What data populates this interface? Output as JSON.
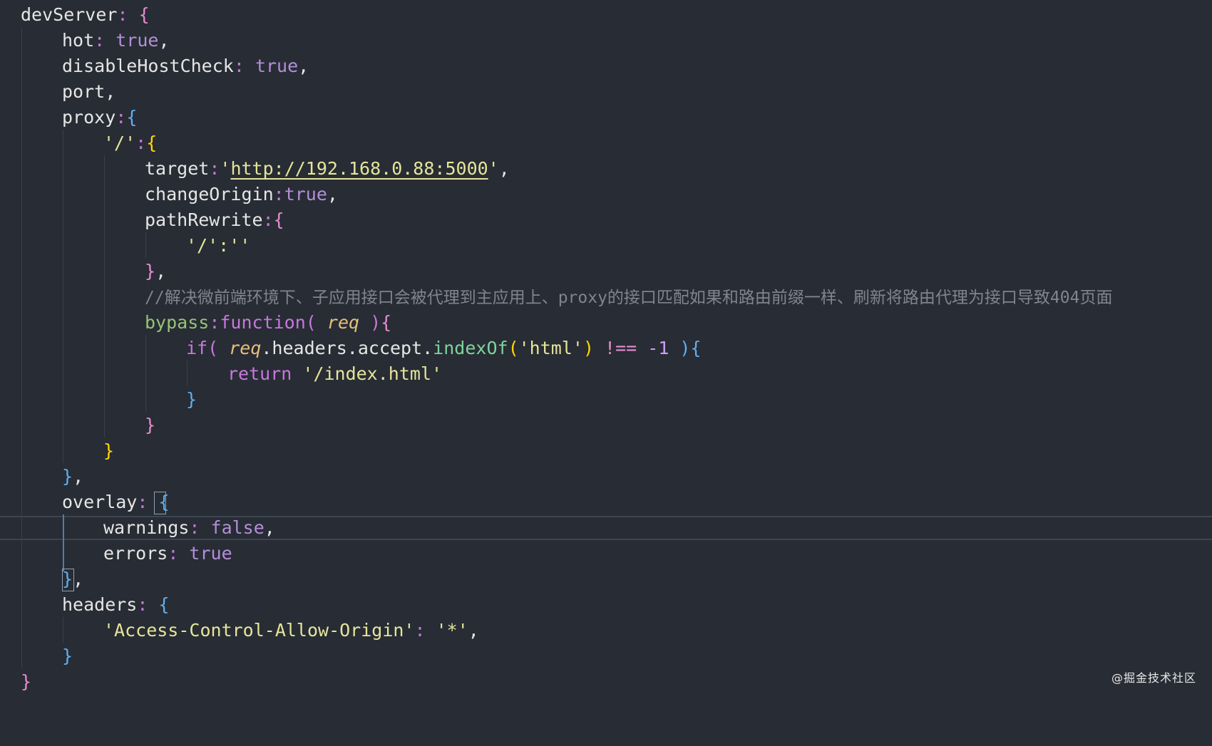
{
  "editor": {
    "lines": {
      "l1": {
        "key": "devServer",
        "colon": ": ",
        "open": "{"
      },
      "l2": {
        "key": "hot",
        "colon": ": ",
        "value": "true",
        "comma": ","
      },
      "l3": {
        "key": "disableHostCheck",
        "colon": ": ",
        "value": "true",
        "comma": ","
      },
      "l4": {
        "text": "port,"
      },
      "l5": {
        "key": "proxy",
        "colon": ":",
        "open": "{"
      },
      "l6": {
        "key": "'/'",
        "colon": ":",
        "open": "{"
      },
      "l7": {
        "key": "target",
        "colon": ":",
        "q1": "'",
        "url": "http://192.168.0.88:5000",
        "q2": "'",
        "comma": ","
      },
      "l8": {
        "key": "changeOrigin",
        "colon": ":",
        "value": "true",
        "comma": ","
      },
      "l9": {
        "key": "pathRewrite",
        "colon": ":",
        "open": "{"
      },
      "l10": {
        "text": "'/':''"
      },
      "l11": {
        "close": "}",
        "comma": ","
      },
      "l12": {
        "comment": "//解决微前端环境下、子应用接口会被代理到主应用上、proxy的接口匹配如果和路由前缀一样、刷新将路由代理为接口导致404页面"
      },
      "l13": {
        "key": "bypass",
        "colon": ":",
        "fn": "function",
        "open_paren": "( ",
        "param": "req",
        "close_paren": " )",
        "open": "{"
      },
      "l14": {
        "kw": "if",
        "open_paren": "( ",
        "param": "req",
        "chain": ".headers.accept.",
        "method": "indexOf",
        "lp": "(",
        "str": "'html'",
        "rp": ")",
        "op": " !== ",
        "num": "-1",
        "close_paren": " )",
        "open": "{"
      },
      "l15": {
        "kw": "return",
        "str": "'/index.html'"
      },
      "l16": {
        "close": "}"
      },
      "l17": {
        "close": "}"
      },
      "l18": {
        "close": "}"
      },
      "l19": {
        "close": "}",
        "comma": ","
      },
      "l20": {
        "key": "overlay",
        "colon": ": ",
        "open": "{"
      },
      "l21": {
        "key": "warnings",
        "colon": ": ",
        "value": "false",
        "comma": ","
      },
      "l22": {
        "key": "errors",
        "colon": ": ",
        "value": "true"
      },
      "l23": {
        "close": "}",
        "comma": ","
      },
      "l24": {
        "key": "headers",
        "colon": ": ",
        "open": "{"
      },
      "l25": {
        "str": "'Access-Control-Allow-Origin'",
        "colon": ": ",
        "value": "'*'",
        "comma": ","
      },
      "l26": {
        "close": "}"
      },
      "l27": {
        "close": "}"
      }
    },
    "colors": {
      "background": "#282c34",
      "property": "#e6e6e6",
      "punctuation": "#c678dd",
      "boolean": "#b38fd9",
      "string": "#e5e59a",
      "comment": "#7f848e",
      "function": "#98c379",
      "parameter": "#e5c07b"
    }
  },
  "watermark": "@掘金技术社区"
}
